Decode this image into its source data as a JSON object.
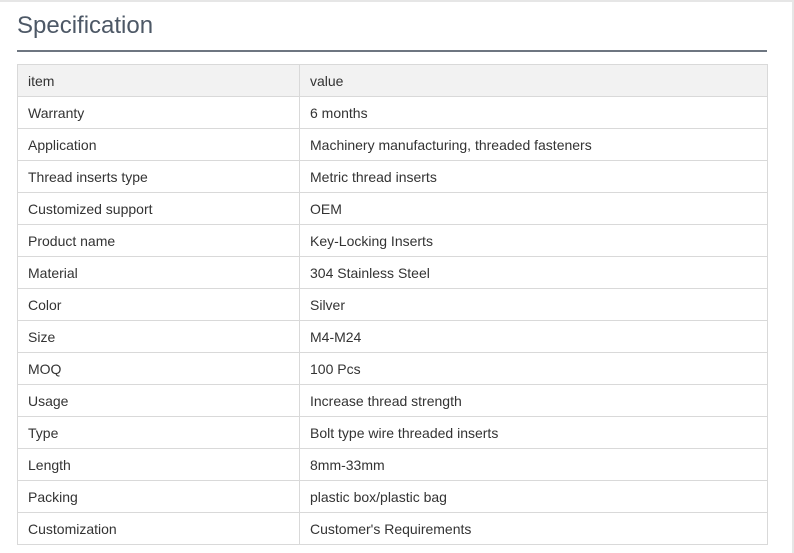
{
  "section": {
    "title": "Specification"
  },
  "table": {
    "headers": [
      "item",
      "value"
    ],
    "rows": [
      [
        "Warranty",
        "6 months"
      ],
      [
        "Application",
        "Machinery manufacturing, threaded fasteners"
      ],
      [
        "Thread inserts type",
        "Metric thread inserts"
      ],
      [
        "Customized support",
        "OEM"
      ],
      [
        "Product name",
        "Key-Locking Inserts"
      ],
      [
        "Material",
        "304 Stainless Steel"
      ],
      [
        "Color",
        "Silver"
      ],
      [
        "Size",
        "M4-M24"
      ],
      [
        "MOQ",
        "100 Pcs"
      ],
      [
        "Usage",
        "Increase thread strength"
      ],
      [
        "Type",
        "Bolt type wire threaded inserts"
      ],
      [
        "Length",
        "8mm-33mm"
      ],
      [
        "Packing",
        "plastic box/plastic bag"
      ],
      [
        "Customization",
        "Customer's Requirements"
      ]
    ]
  }
}
